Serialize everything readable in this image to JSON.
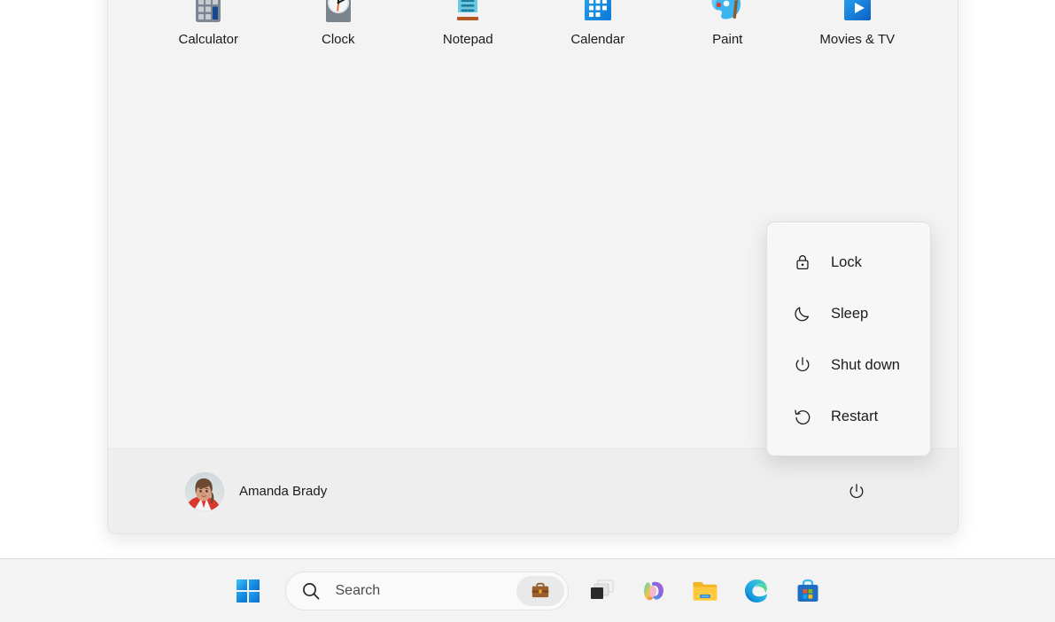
{
  "start_menu": {
    "pinned_apps": [
      {
        "label": "Calculator",
        "icon": "calculator-icon"
      },
      {
        "label": "Clock",
        "icon": "clock-icon"
      },
      {
        "label": "Notepad",
        "icon": "notepad-icon"
      },
      {
        "label": "Calendar",
        "icon": "calendar-icon"
      },
      {
        "label": "Paint",
        "icon": "paint-icon"
      },
      {
        "label": "Movies & TV",
        "icon": "movies-tv-icon"
      }
    ],
    "account": {
      "name": "Amanda Brady",
      "avatar_icon": "user-avatar-photo"
    },
    "power_button_icon": "power-icon"
  },
  "power_flyout": {
    "items": [
      {
        "label": "Lock",
        "icon": "lock-icon"
      },
      {
        "label": "Sleep",
        "icon": "moon-icon"
      },
      {
        "label": "Shut down",
        "icon": "power-icon"
      },
      {
        "label": "Restart",
        "icon": "restart-icon"
      }
    ]
  },
  "taskbar": {
    "start_button_label": "Start",
    "start_icon": "windows-logo-icon",
    "search": {
      "placeholder": "Search",
      "search_icon": "search-icon",
      "badge_icon": "briefcase-icon"
    },
    "buttons": [
      {
        "label": "Task view",
        "icon": "task-view-icon"
      },
      {
        "label": "Copilot",
        "icon": "copilot-icon"
      },
      {
        "label": "File Explorer",
        "icon": "file-explorer-icon"
      },
      {
        "label": "Microsoft Edge",
        "icon": "edge-icon"
      },
      {
        "label": "Microsoft Store",
        "icon": "microsoft-store-icon"
      }
    ]
  },
  "colors": {
    "panel_bg": "#f3f3f3",
    "footer_bg": "#eeeeee",
    "flyout_bg": "#f7f7f7",
    "taskbar_bg": "#f3f3f3",
    "text": "#1b1b1b",
    "accent_blue": "#0078d4"
  }
}
